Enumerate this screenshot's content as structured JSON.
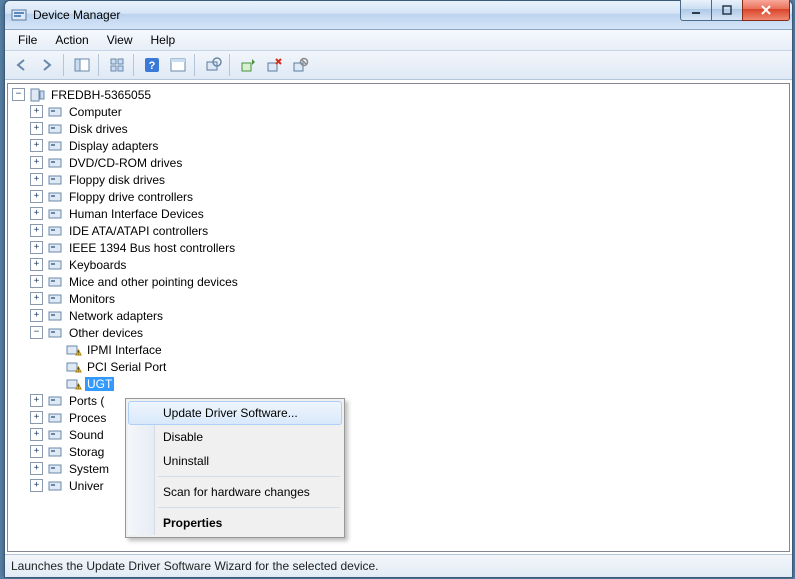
{
  "window": {
    "title": "Device Manager"
  },
  "menubar": {
    "items": [
      "File",
      "Action",
      "View",
      "Help"
    ]
  },
  "tree": {
    "root": {
      "label": "FREDBH-5365055"
    },
    "categories": [
      {
        "label": "Computer",
        "expander": "+"
      },
      {
        "label": "Disk drives",
        "expander": "+"
      },
      {
        "label": "Display adapters",
        "expander": "+"
      },
      {
        "label": "DVD/CD-ROM drives",
        "expander": "+"
      },
      {
        "label": "Floppy disk drives",
        "expander": "+"
      },
      {
        "label": "Floppy drive controllers",
        "expander": "+"
      },
      {
        "label": "Human Interface Devices",
        "expander": "+"
      },
      {
        "label": "IDE ATA/ATAPI controllers",
        "expander": "+"
      },
      {
        "label": "IEEE 1394 Bus host controllers",
        "expander": "+"
      },
      {
        "label": "Keyboards",
        "expander": "+"
      },
      {
        "label": "Mice and other pointing devices",
        "expander": "+"
      },
      {
        "label": "Monitors",
        "expander": "+"
      },
      {
        "label": "Network adapters",
        "expander": "+"
      },
      {
        "label": "Other devices",
        "expander": "−",
        "children": [
          {
            "label": "IPMI Interface"
          },
          {
            "label": "PCI Serial Port"
          },
          {
            "label": "UGT",
            "selected": true
          }
        ]
      },
      {
        "label": "Ports (",
        "expander": "+"
      },
      {
        "label": "Proces",
        "expander": "+"
      },
      {
        "label": "Sound",
        "expander": "+"
      },
      {
        "label": "Storag",
        "expander": "+"
      },
      {
        "label": "System",
        "expander": "+"
      },
      {
        "label": "Univer",
        "expander": "+"
      }
    ]
  },
  "context_menu": {
    "items": [
      {
        "label": "Update Driver Software...",
        "highlighted": true
      },
      {
        "label": "Disable"
      },
      {
        "label": "Uninstall"
      },
      {
        "separator": true
      },
      {
        "label": "Scan for hardware changes"
      },
      {
        "separator": true
      },
      {
        "label": "Properties",
        "bold": true
      }
    ]
  },
  "statusbar": {
    "text": "Launches the Update Driver Software Wizard for the selected device."
  }
}
